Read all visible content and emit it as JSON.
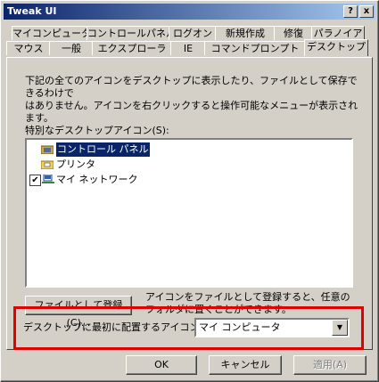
{
  "window": {
    "title": "Tweak UI",
    "help_btn": "?",
    "close_btn": "x"
  },
  "tabs_row1": [
    "マイコンピュータ",
    "コントロールパネル",
    "ログオン",
    "新規作成",
    "修復",
    "パラノイア"
  ],
  "tabs_row2": [
    "マウス",
    "一般",
    "エクスプローラ",
    "IE",
    "コマンドプロンプト",
    "デスクトップ"
  ],
  "panel": {
    "description_line1": "下記の全てのアイコンをデスクトップに表示したり、ファイルとして保存できるわけで",
    "description_line2": "はありません。アイコンを右クリックすると操作可能なメニューが表示されます。",
    "list_label": "特別なデスクトップアイコン(S):",
    "list_items": [
      {
        "label": "コントロール パネル",
        "icon": "control-panel-icon",
        "checked": null,
        "selected": true
      },
      {
        "label": "プリンタ",
        "icon": "printer-folder-icon",
        "checked": null,
        "selected": false
      },
      {
        "label": "マイ ネットワーク",
        "icon": "network-icon",
        "checked": true,
        "selected": false
      }
    ],
    "register_button": "ファイルとして登録(C)...",
    "register_note_line1": "アイコンをファイルとして登録すると、任意の",
    "register_note_line2": "フォルダに置くことができます。",
    "first_icon_label": "デスクトップに最初に配置するアイコン(F):",
    "first_icon_value": "マイ コンピュータ"
  },
  "footer": {
    "ok": "OK",
    "cancel": "キャンセル",
    "apply": "適用(A)"
  },
  "colors": {
    "title_bar": "#0a246a",
    "highlight_box": "#e00000",
    "face": "#d4d0c8"
  }
}
